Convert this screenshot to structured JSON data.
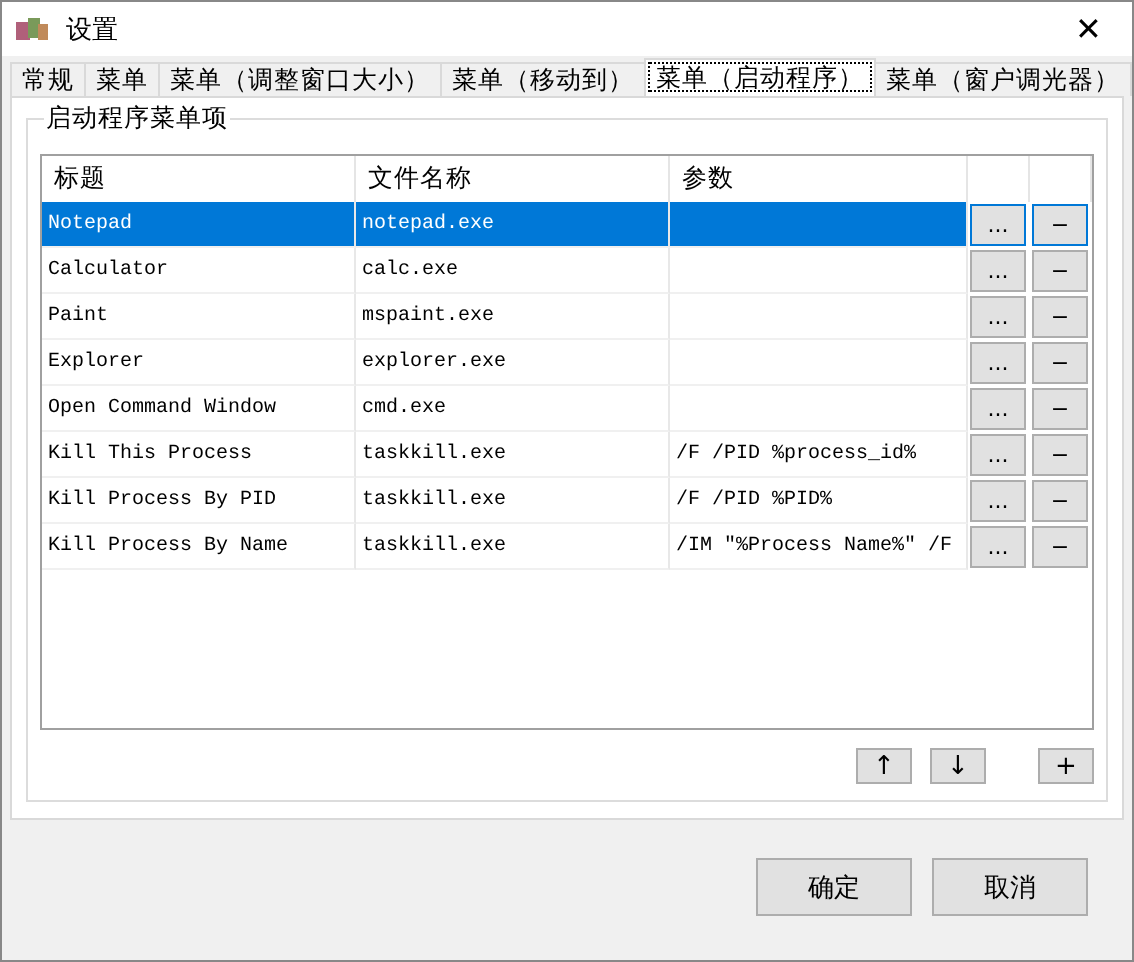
{
  "window": {
    "title": "设置",
    "close": "✕"
  },
  "tabs": [
    {
      "label": "常规",
      "selected": false
    },
    {
      "label": "菜单",
      "selected": false
    },
    {
      "label": "菜单（调整窗口大小）",
      "selected": false
    },
    {
      "label": "菜单（移动到）",
      "selected": false
    },
    {
      "label": "菜单（启动程序）",
      "selected": true
    },
    {
      "label": "菜单（窗户调光器）",
      "selected": false
    }
  ],
  "group": {
    "title": "启动程序菜单项"
  },
  "table": {
    "columns": [
      "标题",
      "文件名称",
      "参数"
    ],
    "rows": [
      {
        "title": "Notepad",
        "file": "notepad.exe",
        "params": "",
        "edit": "...",
        "remove": "−",
        "selected": true
      },
      {
        "title": "Calculator",
        "file": "calc.exe",
        "params": "",
        "edit": "...",
        "remove": "−",
        "selected": false
      },
      {
        "title": "Paint",
        "file": "mspaint.exe",
        "params": "",
        "edit": "...",
        "remove": "−",
        "selected": false
      },
      {
        "title": "Explorer",
        "file": "explorer.exe",
        "params": "",
        "edit": "...",
        "remove": "−",
        "selected": false
      },
      {
        "title": "Open Command Window",
        "file": "cmd.exe",
        "params": "",
        "edit": "...",
        "remove": "−",
        "selected": false
      },
      {
        "title": "Kill This Process",
        "file": "taskkill.exe",
        "params": "/F /PID %process_id%",
        "edit": "...",
        "remove": "−",
        "selected": false
      },
      {
        "title": "Kill Process By PID",
        "file": "taskkill.exe",
        "params": "/F /PID %PID%",
        "edit": "...",
        "remove": "−",
        "selected": false
      },
      {
        "title": "Kill Process By Name",
        "file": "taskkill.exe",
        "params": "/IM \"%Process Name%\" /F",
        "edit": "...",
        "remove": "−",
        "selected": false
      }
    ]
  },
  "list_buttons": {
    "up": "↑",
    "down": "↓",
    "add": "+"
  },
  "buttons": {
    "ok": "确定",
    "cancel": "取消"
  }
}
